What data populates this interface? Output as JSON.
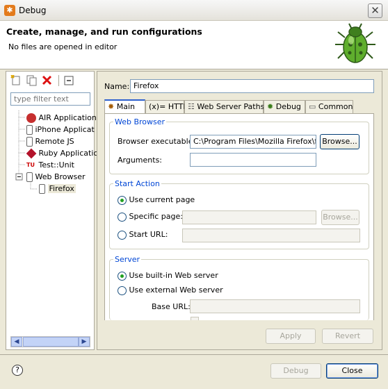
{
  "window": {
    "title": "Debug",
    "close_glyph": "✕"
  },
  "header": {
    "title": "Create, manage, and run configurations",
    "message": "No files are opened in editor"
  },
  "left": {
    "filter_placeholder": "type filter text",
    "tree": [
      {
        "label": "AIR Application",
        "icon": "air-icon",
        "indent": 0
      },
      {
        "label": "iPhone Applicat",
        "icon": "iphone-icon",
        "indent": 0
      },
      {
        "label": "Remote JS",
        "icon": "remote-js-icon",
        "indent": 0
      },
      {
        "label": "Ruby Applicatic",
        "icon": "ruby-icon",
        "indent": 0
      },
      {
        "label": "Test::Unit",
        "icon": "test-unit-icon",
        "indent": 0
      },
      {
        "label": "Web Browser",
        "icon": "web-browser-icon",
        "indent": 0,
        "expanded": true
      },
      {
        "label": "Firefox",
        "icon": "firefox-config-icon",
        "indent": 1,
        "selected": true
      }
    ]
  },
  "main": {
    "name_label": "Name:",
    "name_value": "Firefox",
    "tabs": [
      {
        "label": "Main",
        "icon": "main-tab-icon",
        "active": true
      },
      {
        "label": "HTTP",
        "icon": "http-tab-icon",
        "active": false
      },
      {
        "label": "Web Server Paths",
        "icon": "web-server-paths-icon",
        "active": false
      },
      {
        "label": "Debug",
        "icon": "debug-tab-icon",
        "active": false
      },
      {
        "label": "Common",
        "icon": "common-tab-icon",
        "active": false
      }
    ],
    "http_prefix": "(x)=",
    "web_browser": {
      "title": "Web Browser",
      "exe_label": "Browser executable:",
      "exe_value": "C:\\Program Files\\Mozilla Firefox\\fire",
      "browse": "Browse...",
      "args_label": "Arguments:",
      "args_value": ""
    },
    "start_action": {
      "title": "Start Action",
      "use_current": "Use current page",
      "specific": "Specific page:",
      "specific_value": "",
      "browse": "Browse...",
      "start_url": "Start URL:",
      "start_url_value": ""
    },
    "server": {
      "title": "Server",
      "builtin": "Use built-in Web server",
      "external": "Use external Web server",
      "base_url": "Base URL:",
      "base_url_value": ""
    },
    "apply": "Apply",
    "revert": "Revert"
  },
  "footer": {
    "help": "?",
    "debug": "Debug",
    "close": "Close"
  },
  "colors": {
    "accent": "#2c60ce",
    "group_title": "#0046d5",
    "radio_dot": "#21a121"
  }
}
